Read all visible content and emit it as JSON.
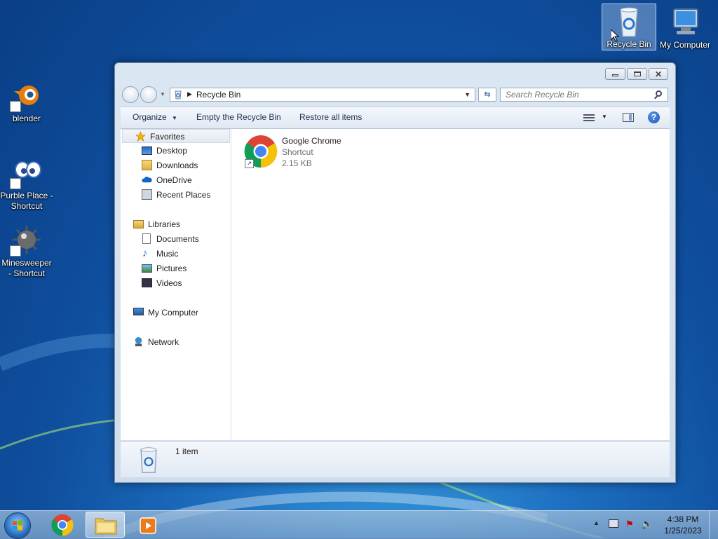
{
  "desktop": {
    "icons": [
      {
        "label": "blender"
      },
      {
        "label": "Purble Place - Shortcut"
      },
      {
        "label": "Minesweeper - Shortcut"
      },
      {
        "label": "Recycle Bin"
      },
      {
        "label": "My Computer"
      }
    ]
  },
  "window": {
    "address": {
      "current": "Recycle Bin"
    },
    "search": {
      "placeholder": "Search Recycle Bin"
    },
    "commands": {
      "organize": "Organize",
      "empty": "Empty the Recycle Bin",
      "restore": "Restore all items"
    },
    "nav": {
      "favorites": "Favorites",
      "desktop": "Desktop",
      "downloads": "Downloads",
      "onedrive": "OneDrive",
      "recent": "Recent Places",
      "libraries": "Libraries",
      "documents": "Documents",
      "music": "Music",
      "pictures": "Pictures",
      "videos": "Videos",
      "mycomputer": "My Computer",
      "network": "Network"
    },
    "files": [
      {
        "name": "Google Chrome",
        "type": "Shortcut",
        "size": "2.15 KB"
      }
    ],
    "status": {
      "count": "1 item"
    }
  },
  "taskbar": {
    "clock": {
      "time": "4:38 PM",
      "date": "1/25/2023"
    }
  },
  "colors": {
    "desktop_blue": "#1d6fc0",
    "window_frame": "#dbe6f3",
    "selection": "#e4e9f0"
  }
}
